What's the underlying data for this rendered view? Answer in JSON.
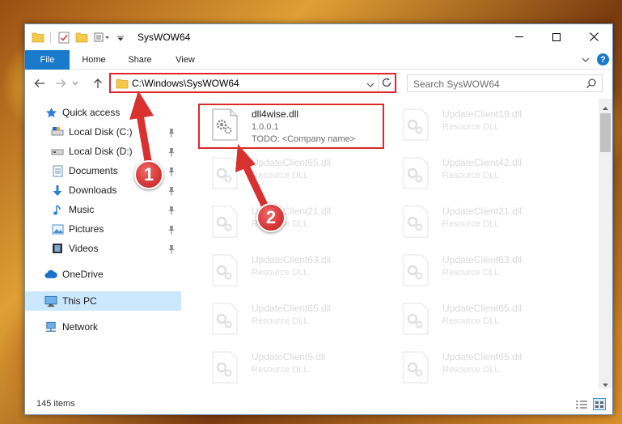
{
  "window": {
    "title": "SysWOW64"
  },
  "ribbon": {
    "tabs": [
      "File",
      "Home",
      "Share",
      "View"
    ]
  },
  "address": {
    "path": "C:\\Windows\\SysWOW64"
  },
  "search": {
    "placeholder": "Search SysWOW64"
  },
  "sidebar": {
    "quick_access": "Quick access",
    "items": [
      "Local Disk (C:)",
      "Local Disk (D:)",
      "Documents",
      "Downloads",
      "Music",
      "Pictures",
      "Videos"
    ],
    "onedrive": "OneDrive",
    "this_pc": "This PC",
    "network": "Network"
  },
  "files": [
    {
      "name": "dll4wise.dll",
      "line1": "1.0.0.1",
      "line2": "TODO: <Company name>"
    },
    {
      "name": "UpdateClient19.dll",
      "line1": "Resource DLL"
    },
    {
      "name": "UpdateClient65.dll",
      "line1": "Resource DLL"
    },
    {
      "name": "UpdateClient42.dll",
      "line1": "Resource DLL"
    },
    {
      "name": "UpdateClient21.dll",
      "line1": "Resource DLL"
    },
    {
      "name": "UpdateClient21.dll",
      "line1": "Resource DLL"
    },
    {
      "name": "UpdateClient63.dll",
      "line1": "Resource DLL"
    },
    {
      "name": "UpdateClient63.dll",
      "line1": "Resource DLL"
    },
    {
      "name": "UpdateClient65.dll",
      "line1": "Resource DLL"
    },
    {
      "name": "UpdateClient65.dll",
      "line1": "Resource DLL"
    },
    {
      "name": "UpdateClient5.dll",
      "line1": "Resource DLL"
    },
    {
      "name": "UpdateClient65.dll",
      "line1": "Resource DLL"
    }
  ],
  "status": {
    "count": "145 items"
  },
  "annotations": {
    "step1": "1",
    "step2": "2"
  },
  "colors": {
    "accent": "#1979ca",
    "highlight": "#d92a2a",
    "selection": "#cce8ff"
  }
}
